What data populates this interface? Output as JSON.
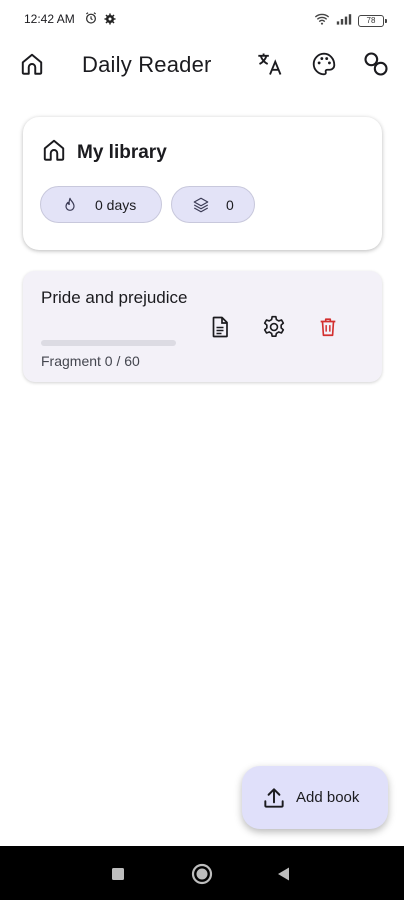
{
  "status_bar": {
    "time": "12:42 AM",
    "battery": "78",
    "icons": [
      "alarm-icon",
      "settings-gear-icon",
      "wifi-icon",
      "signal-icon",
      "battery-icon"
    ]
  },
  "app_bar": {
    "title": "Daily Reader",
    "icons": [
      "home-icon",
      "translate-icon",
      "palette-icon",
      "link-icon"
    ]
  },
  "library": {
    "title": "My library",
    "icon": "home-icon",
    "streak_chip": {
      "icon": "flame-icon",
      "label": "0 days"
    },
    "layers_chip": {
      "icon": "layers-icon",
      "label": "0"
    }
  },
  "books": [
    {
      "title": "Pride and prejudice",
      "progress": 0,
      "fragment_label": "Fragment 0 / 60",
      "actions": [
        "document-icon",
        "settings-icon",
        "delete-icon"
      ]
    }
  ],
  "fab": {
    "label": "Add book",
    "icon": "upload-icon"
  },
  "colors": {
    "accent_chip": "#e3e3f7",
    "fab_bg": "#e0e0fa",
    "delete": "#d32f2f",
    "card_bg": "#f3f1f8"
  },
  "nav_bar": {
    "buttons": [
      "recents-button",
      "home-button",
      "back-button"
    ]
  }
}
